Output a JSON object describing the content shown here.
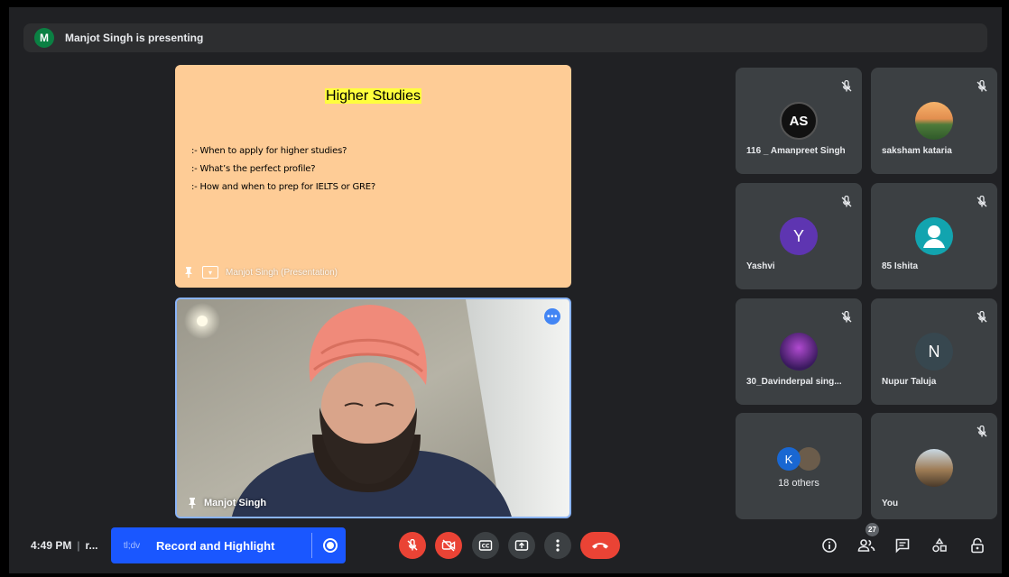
{
  "banner": {
    "avatar_letter": "M",
    "text": "Manjot Singh is presenting"
  },
  "slide": {
    "title": "Higher Studies",
    "bullets": [
      ":- When to apply for higher studies?",
      ":- What’s the perfect profile?",
      ":- How and when to prep for IELTS or GRE?"
    ],
    "footer_label": "Manjot Singh (Presentation)"
  },
  "camera": {
    "name": "Manjot Singh"
  },
  "participants": [
    {
      "name": "116 _ Amanpreet Singh",
      "avatar": "AS",
      "muted": true
    },
    {
      "name": "saksham kataria",
      "avatar": "",
      "muted": true
    },
    {
      "name": "Yashvi",
      "avatar": "Y",
      "muted": true
    },
    {
      "name": "85 Ishita",
      "avatar": "",
      "muted": true
    },
    {
      "name": "30_Davinderpal sing...",
      "avatar": "",
      "muted": true
    },
    {
      "name": "Nupur Taluja",
      "avatar": "N",
      "muted": true
    },
    {
      "name": "",
      "avatar": "K",
      "muted": false
    },
    {
      "name": "You",
      "avatar": "",
      "muted": true
    }
  ],
  "others_label": "18 others",
  "bottom": {
    "time": "4:49 PM",
    "meeting_code": "r...",
    "record_brand": "tl;dv",
    "record_label": "Record and Highlight",
    "participant_count": "27"
  },
  "colors": {
    "accent": "#8ab4f8",
    "danger": "#ea4335",
    "record": "#1a57ff",
    "slide_bg": "#fecc96",
    "highlight": "#ffff3d"
  },
  "icons": [
    "mic-off-icon",
    "camera-off-icon",
    "captions-icon",
    "present-now-icon",
    "more-vert-icon",
    "call-end-icon",
    "info-icon",
    "people-icon",
    "chat-icon",
    "activities-icon",
    "host-controls-icon",
    "pin-icon"
  ]
}
